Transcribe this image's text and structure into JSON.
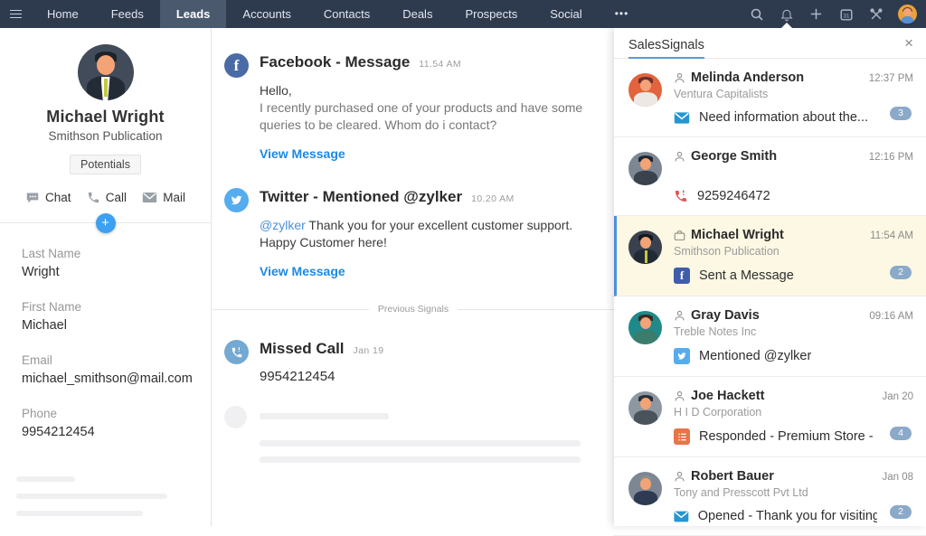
{
  "nav": {
    "items": [
      "Home",
      "Feeds",
      "Leads",
      "Accounts",
      "Contacts",
      "Deals",
      "Prospects",
      "Social"
    ],
    "active_item": "Leads",
    "more_label": "•••",
    "icons": [
      "hamburger-icon",
      "search-icon",
      "bell-icon",
      "plus-icon",
      "calendar-icon",
      "tools-icon",
      "user-avatar"
    ]
  },
  "lead_profile": {
    "name": "Michael Wright",
    "company": "Smithson Publication",
    "badge": "Potentials",
    "actions": [
      {
        "label": "Chat"
      },
      {
        "label": "Call"
      },
      {
        "label": "Mail"
      }
    ],
    "fields": [
      {
        "label": "Last Name",
        "value": "Wright"
      },
      {
        "label": "First Name",
        "value": "Michael"
      },
      {
        "label": "Email",
        "value": "michael_smithson@mail.com"
      },
      {
        "label": "Phone",
        "value": "9954212454"
      }
    ]
  },
  "timeline": {
    "facebook": {
      "title": "Facebook - Message",
      "time": "11.54 AM",
      "greeting": "Hello,",
      "body": "I recently purchased one of your products and have some queries to be cleared. Whom do i contact?",
      "link": "View Message"
    },
    "twitter": {
      "title": "Twitter - Mentioned @zylker",
      "time": "10.20 AM",
      "mention": "@zylker",
      "body": " Thank you for your excellent customer support. Happy Customer here!",
      "link": "View Message"
    },
    "divider": "Previous Signals",
    "missed_call": {
      "title": "Missed Call",
      "time": "Jan 19",
      "number": "9954212454"
    }
  },
  "signals": {
    "title": "SalesSignals",
    "close": "×",
    "items": [
      {
        "name": "Melinda Anderson",
        "company": "Ventura Capitalists",
        "time": "12:37 PM",
        "channel": "email",
        "message": "Need information about the...",
        "badge": "3"
      },
      {
        "name": "George Smith",
        "company": "",
        "time": "12:16 PM",
        "channel": "missed-call",
        "message": "9259246472",
        "badge": ""
      },
      {
        "name": "Michael Wright",
        "company": "Smithson Publication",
        "time": "11:54 AM",
        "channel": "facebook",
        "message": "Sent a Message",
        "badge": "2"
      },
      {
        "name": "Gray Davis",
        "company": "Treble Notes Inc",
        "time": "09:16 AM",
        "channel": "twitter",
        "message": "Mentioned @zylker",
        "badge": ""
      },
      {
        "name": "Joe Hackett",
        "company": "H I D Corporation",
        "time": "Jan 20",
        "channel": "survey",
        "message": "Responded - Premium Store - Fee...",
        "badge": "4"
      },
      {
        "name": "Robert Bauer",
        "company": "Tony and Presscott Pvt Ltd",
        "time": "Jan 08",
        "channel": "email",
        "message": "Opened - Thank you for visiting...",
        "badge": "2"
      }
    ],
    "facebook_glyph": "f"
  },
  "colors": {
    "nav_background": "#2e3a4e",
    "nav_active_tab": "#4b596e",
    "accent_blue": "#4a90d9",
    "link_blue": "#1e88e5",
    "highlight_row": "#fcf8e3",
    "badge_pill": "#8ba9c8",
    "facebook": "#4a6ba6",
    "twitter": "#55acee",
    "missed_call_red": "#e25050",
    "survey_orange": "#e8744a",
    "email_blue": "#2596d1",
    "add_button": "#3da0f2"
  }
}
